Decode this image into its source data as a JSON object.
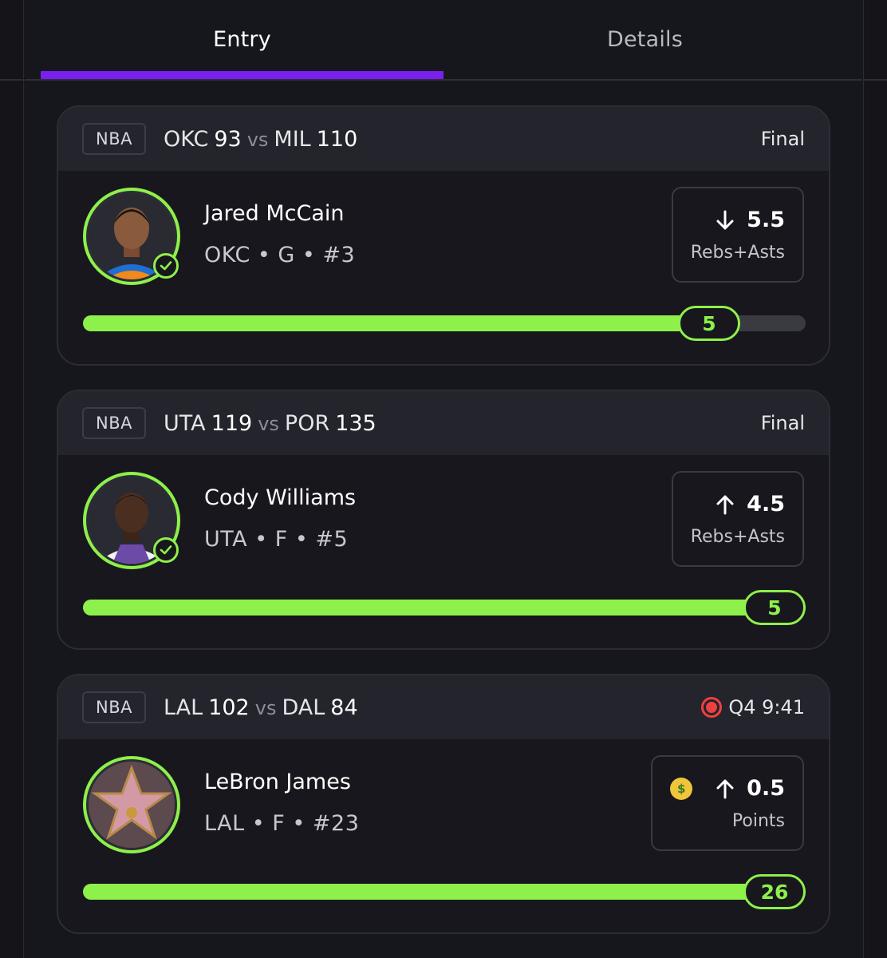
{
  "tabs": [
    {
      "label": "Entry",
      "active": true
    },
    {
      "label": "Details",
      "active": false
    }
  ],
  "colors": {
    "accent_purple": "#7a1ff0",
    "progress_green": "#8ef04a",
    "live_red": "#ef4040",
    "background": "#17171d"
  },
  "picks": [
    {
      "league": "NBA",
      "home_team": "OKC",
      "home_score": "93",
      "vs": "vs",
      "away_team": "MIL",
      "away_score": "110",
      "status": "Final",
      "live": false,
      "player_name": "Jared McCain",
      "player_meta": "OKC • G • #3",
      "direction_icon": "arrow-down-icon",
      "line": "5.5",
      "stat": "Rebs+Asts",
      "actual": "5",
      "progress_fraction": 0.91,
      "has_emoji": false
    },
    {
      "league": "NBA",
      "home_team": "UTA",
      "home_score": "119",
      "vs": "vs",
      "away_team": "POR",
      "away_score": "135",
      "status": "Final",
      "live": false,
      "player_name": "Cody Williams",
      "player_meta": "UTA • F • #5",
      "direction_icon": "arrow-up-icon",
      "line": "4.5",
      "stat": "Rebs+Asts",
      "actual": "5",
      "progress_fraction": 1.0,
      "has_emoji": false
    },
    {
      "league": "NBA",
      "home_team": "LAL",
      "home_score": "102",
      "vs": "vs",
      "away_team": "DAL",
      "away_score": "84",
      "status": "Q4 9:41",
      "live": true,
      "player_name": "LeBron James",
      "player_meta": "LAL • F • #23",
      "direction_icon": "arrow-up-icon",
      "line": "0.5",
      "stat": "Points",
      "actual": "26",
      "progress_fraction": 1.0,
      "has_emoji": true,
      "emoji_icon": "money-mouth-face-icon"
    }
  ]
}
